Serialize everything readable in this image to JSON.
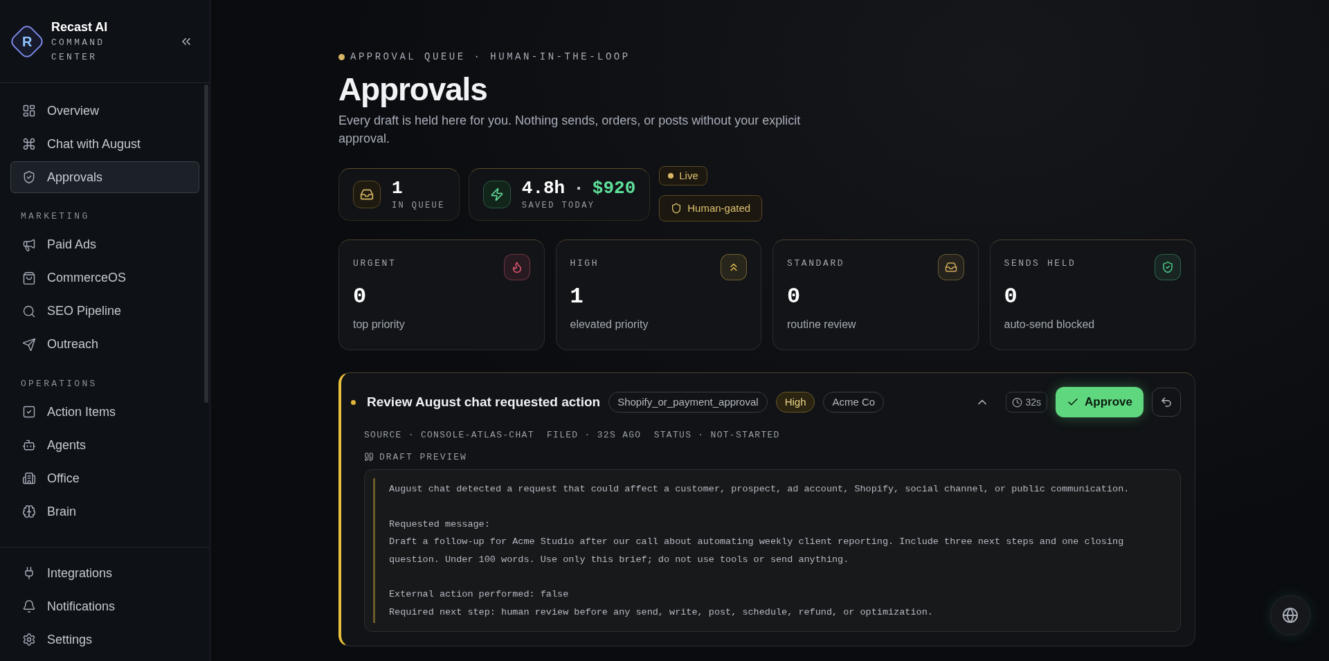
{
  "brand": {
    "logo_letter": "R",
    "name": "Recast AI",
    "subtitle": "COMMAND CENTER"
  },
  "sidebar": {
    "sections": [
      {
        "items": [
          {
            "label": "Overview",
            "selected": false
          },
          {
            "label": "Chat with August",
            "selected": false
          },
          {
            "label": "Approvals",
            "selected": true
          }
        ]
      },
      {
        "heading": "MARKETING",
        "items": [
          {
            "label": "Paid Ads",
            "selected": false
          },
          {
            "label": "CommerceOS",
            "selected": false
          },
          {
            "label": "SEO Pipeline",
            "selected": false
          },
          {
            "label": "Outreach",
            "selected": false
          }
        ]
      },
      {
        "heading": "OPERATIONS",
        "items": [
          {
            "label": "Action Items",
            "selected": false
          },
          {
            "label": "Agents",
            "selected": false
          },
          {
            "label": "Office",
            "selected": false
          },
          {
            "label": "Brain",
            "selected": false
          }
        ]
      }
    ],
    "footer_items": [
      {
        "label": "Integrations",
        "selected": false
      },
      {
        "label": "Notifications",
        "selected": false
      },
      {
        "label": "Settings",
        "selected": false
      }
    ]
  },
  "header": {
    "eyebrow": "APPROVAL QUEUE · HUMAN-IN-THE-LOOP",
    "title": "Approvals",
    "description": "Every draft is held here for you. Nothing sends, orders, or posts without your explicit approval."
  },
  "summary": [
    {
      "kind": "queue",
      "value": "1",
      "label": "IN QUEUE"
    },
    {
      "kind": "savings",
      "value": "4.8h",
      "separator": "·",
      "highlight": "$920",
      "label": "SAVED TODAY"
    }
  ],
  "badges": [
    {
      "kind": "live",
      "label": "Live"
    },
    {
      "kind": "gate",
      "label": "Human-gated"
    }
  ],
  "priority_cards": [
    {
      "label": "URGENT",
      "value": "0",
      "caption": "top priority",
      "color": "#e05a75"
    },
    {
      "label": "HIGH",
      "value": "1",
      "caption": "elevated priority",
      "color": "#e6c14a"
    },
    {
      "label": "STANDARD",
      "value": "0",
      "caption": "routine review",
      "color": "#cfa95a"
    },
    {
      "label": "SENDS HELD",
      "value": "0",
      "caption": "auto-send blocked",
      "color": "#4fc98a"
    }
  ],
  "approvals": [
    {
      "title": "Review August chat requested action",
      "expanded": true,
      "tags": [
        {
          "kind": "type",
          "label": "Shopify_or_payment_approval"
        },
        {
          "kind": "priority",
          "label": "High"
        },
        {
          "kind": "client",
          "label": "Acme Co"
        }
      ],
      "age": "32s",
      "approve_label": "Approve",
      "meta": "SOURCE · CONSOLE-ATLAS-CHAT  FILED · 32S AGO  STATUS · NOT-STARTED",
      "draft_label": "DRAFT PREVIEW",
      "draft_paragraphs": [
        [
          "August chat detected a request that could affect a customer, prospect, ad account, Shopify, social channel, or public communication."
        ],
        [
          "Requested message:",
          "Draft a follow-up for Acme Studio after our call about automating weekly client reporting. Include three next steps and one closing question. Under 100 words. Use only this brief; do not use tools or send anything."
        ],
        [
          "External action performed: false",
          "Required next step: human review before any send, write, post, schedule, refund, or optimization."
        ]
      ]
    }
  ]
}
